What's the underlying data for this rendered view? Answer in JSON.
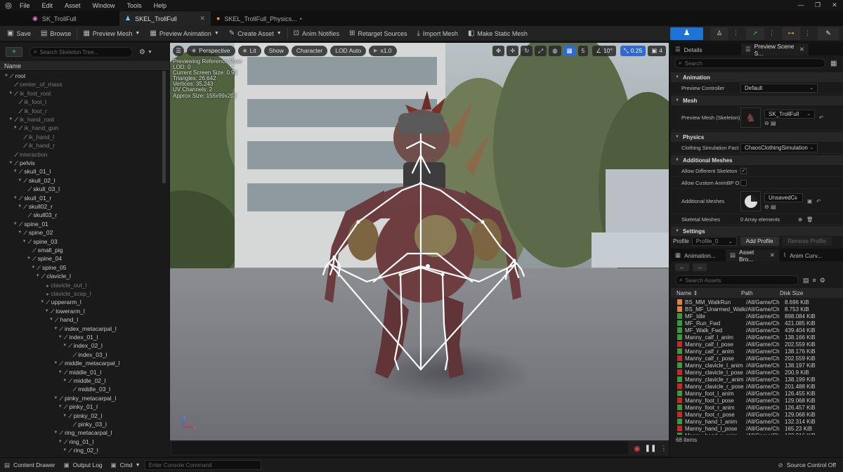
{
  "menu": {
    "items": [
      "File",
      "Edit",
      "Asset",
      "Window",
      "Tools",
      "Help"
    ]
  },
  "window_controls": {
    "min": "—",
    "max": "❐",
    "close": "✕"
  },
  "tabs": [
    {
      "label": "SK_TrollFull",
      "close": "✕"
    },
    {
      "label": "SKEL_TrollFull",
      "close": "✕"
    },
    {
      "label": "SKEL_TrollFull_Physics...",
      "close": "•"
    }
  ],
  "toolbar": {
    "save": "Save",
    "browse": "Browse",
    "preview_mesh": "Preview Mesh",
    "preview_animation": "Preview Animation",
    "create_asset": "Create Asset",
    "anim_notifies": "Anim Notifies",
    "retarget_sources": "Retarget Sources",
    "import_mesh": "Import Mesh",
    "make_static_mesh": "Make Static Mesh"
  },
  "skeleton_tree": {
    "search_placeholder": "Search Skeleton Tree...",
    "column_name": "Name",
    "rows": [
      {
        "label": "root",
        "depth": 0,
        "type": "bone",
        "toggle": true,
        "dim": false
      },
      {
        "label": "center_of_mass",
        "depth": 1,
        "type": "bone",
        "toggle": false,
        "dim": true
      },
      {
        "label": "ik_foot_root",
        "depth": 1,
        "type": "bone",
        "toggle": true,
        "dim": true
      },
      {
        "label": "ik_foot_l",
        "depth": 2,
        "type": "bone",
        "toggle": false,
        "dim": true
      },
      {
        "label": "ik_foot_r",
        "depth": 2,
        "type": "bone",
        "toggle": false,
        "dim": true
      },
      {
        "label": "ik_hand_root",
        "depth": 1,
        "type": "bone",
        "toggle": true,
        "dim": true
      },
      {
        "label": "ik_hand_gun",
        "depth": 2,
        "type": "bone",
        "toggle": true,
        "dim": true
      },
      {
        "label": "ik_hand_l",
        "depth": 3,
        "type": "bone",
        "toggle": false,
        "dim": true
      },
      {
        "label": "ik_hand_r",
        "depth": 3,
        "type": "bone",
        "toggle": false,
        "dim": true
      },
      {
        "label": "interaction",
        "depth": 1,
        "type": "bone",
        "toggle": false,
        "dim": true
      },
      {
        "label": "pelvis",
        "depth": 1,
        "type": "bone",
        "toggle": true,
        "dim": false
      },
      {
        "label": "skull_01_l",
        "depth": 2,
        "type": "bone",
        "toggle": true,
        "dim": false
      },
      {
        "label": "skull_02_l",
        "depth": 3,
        "type": "bone",
        "toggle": true,
        "dim": false
      },
      {
        "label": "skull_03_l",
        "depth": 4,
        "type": "bone",
        "toggle": false,
        "dim": false
      },
      {
        "label": "skull_01_r",
        "depth": 2,
        "type": "bone",
        "toggle": true,
        "dim": false
      },
      {
        "label": "skull02_r",
        "depth": 3,
        "type": "bone",
        "toggle": true,
        "dim": false
      },
      {
        "label": "skull03_r",
        "depth": 4,
        "type": "bone",
        "toggle": false,
        "dim": false
      },
      {
        "label": "spine_01",
        "depth": 2,
        "type": "bone",
        "toggle": true,
        "dim": false
      },
      {
        "label": "spine_02",
        "depth": 3,
        "type": "bone",
        "toggle": true,
        "dim": false
      },
      {
        "label": "spine_03",
        "depth": 4,
        "type": "bone",
        "toggle": true,
        "dim": false
      },
      {
        "label": "small_pig",
        "depth": 5,
        "type": "bone",
        "toggle": false,
        "dim": false
      },
      {
        "label": "spine_04",
        "depth": 5,
        "type": "bone",
        "toggle": true,
        "dim": false
      },
      {
        "label": "spine_05",
        "depth": 6,
        "type": "bone",
        "toggle": true,
        "dim": false
      },
      {
        "label": "clavicle_l",
        "depth": 7,
        "type": "bone",
        "toggle": true,
        "dim": false
      },
      {
        "label": "clavicle_out_l",
        "depth": 8,
        "type": "socket",
        "toggle": false,
        "dim": true
      },
      {
        "label": "clavicle_scap_l",
        "depth": 8,
        "type": "socket",
        "toggle": false,
        "dim": true
      },
      {
        "label": "upperarm_l",
        "depth": 8,
        "type": "bone",
        "toggle": true,
        "dim": false
      },
      {
        "label": "lowerarm_l",
        "depth": 9,
        "type": "bone",
        "toggle": true,
        "dim": false
      },
      {
        "label": "hand_l",
        "depth": 10,
        "type": "bone",
        "toggle": true,
        "dim": false
      },
      {
        "label": "index_metacarpal_l",
        "depth": 11,
        "type": "bone",
        "toggle": true,
        "dim": false
      },
      {
        "label": "index_01_l",
        "depth": 12,
        "type": "bone",
        "toggle": true,
        "dim": false
      },
      {
        "label": "index_02_l",
        "depth": 13,
        "type": "bone",
        "toggle": true,
        "dim": false
      },
      {
        "label": "index_03_l",
        "depth": 14,
        "type": "bone",
        "toggle": false,
        "dim": false
      },
      {
        "label": "middle_metacarpal_l",
        "depth": 11,
        "type": "bone",
        "toggle": true,
        "dim": false
      },
      {
        "label": "middle_01_l",
        "depth": 12,
        "type": "bone",
        "toggle": true,
        "dim": false
      },
      {
        "label": "middle_02_l",
        "depth": 13,
        "type": "bone",
        "toggle": true,
        "dim": false
      },
      {
        "label": "middle_03_l",
        "depth": 14,
        "type": "bone",
        "toggle": false,
        "dim": false
      },
      {
        "label": "pinky_metacarpal_l",
        "depth": 11,
        "type": "bone",
        "toggle": true,
        "dim": false
      },
      {
        "label": "pinky_01_l",
        "depth": 12,
        "type": "bone",
        "toggle": true,
        "dim": false
      },
      {
        "label": "pinky_02_l",
        "depth": 13,
        "type": "bone",
        "toggle": true,
        "dim": false
      },
      {
        "label": "pinky_03_l",
        "depth": 14,
        "type": "bone",
        "toggle": false,
        "dim": false
      },
      {
        "label": "ring_metacarpal_l",
        "depth": 11,
        "type": "bone",
        "toggle": true,
        "dim": false
      },
      {
        "label": "ring_01_l",
        "depth": 12,
        "type": "bone",
        "toggle": true,
        "dim": false
      },
      {
        "label": "ring_02_l",
        "depth": 13,
        "type": "bone",
        "toggle": true,
        "dim": false
      }
    ]
  },
  "viewport": {
    "perspective": "Perspective",
    "lit": "Lit",
    "show": "Show",
    "character": "Character",
    "lod": "LOD Auto",
    "play_rate": "x1.0",
    "grid_size": "5",
    "angle": "10°",
    "scale": "0.25",
    "camera_speed": "4",
    "info_lines": [
      "Previewing Reference Pose",
      "LOD: 0",
      "Current Screen Size: 0.92",
      "Triangles: 26,642",
      "Vertices: 35,243",
      "UV Channels: 2",
      "Approx Size: 156x99x202"
    ],
    "axis_z": "z",
    "axis_x": "x"
  },
  "details": {
    "tab_details": "Details",
    "tab_preview": "Preview Scene S...",
    "search_placeholder": "Search",
    "sec_animation": "Animation",
    "preview_controller_label": "Preview Controller",
    "preview_controller_value": "Default",
    "sec_mesh": "Mesh",
    "preview_mesh_label": "Preview Mesh (Skeleton)",
    "preview_mesh_value": "SK_TrollFull",
    "sec_physics": "Physics",
    "clothing_label": "Clothing Simulation Fact",
    "clothing_value": "ChaosClothingSimulation",
    "sec_additional": "Additional Meshes",
    "allow_diff_label": "Allow Different Skeleton",
    "allow_custom_label": "Allow Custom AnimBP O",
    "additional_meshes_label": "Additional Meshes",
    "additional_meshes_value": "UnsavedCo",
    "skeletal_meshes_label": "Skeletal Meshes",
    "skeletal_meshes_value": "0 Array elements",
    "sec_settings": "Settings",
    "profile_label": "Profile",
    "profile_value": "Profile_0",
    "add_profile": "Add Profile",
    "remove_profile": "Remove Profile"
  },
  "asset_browser": {
    "tab_animation": "Animation...",
    "tab_asset": "Asset Bro...",
    "tab_anim_curves": "Anim Curv...",
    "search_placeholder": "Search Assets",
    "col_name": "Name",
    "col_path": "Path",
    "col_size": "Disk Size",
    "rows": [
      {
        "name": "BS_MM_WalkRun",
        "path": "/All/Game/Ch",
        "size": "8.696 KiB",
        "color": "#d9824a"
      },
      {
        "name": "BS_MF_Unarmed_WalkF",
        "path": "/All/Game/Ch",
        "size": "8.753 KiB",
        "color": "#d9824a"
      },
      {
        "name": "MF_Idle",
        "path": "/All/Game/Ch",
        "size": "898.084 KiB",
        "color": "#3c9a3c"
      },
      {
        "name": "MF_Run_Fwd",
        "path": "/All/Game/Ch",
        "size": "421.085 KiB",
        "color": "#3c9a3c"
      },
      {
        "name": "MF_Walk_Fwd",
        "path": "/All/Game/Ch",
        "size": "439.404 KiB",
        "color": "#3c9a3c"
      },
      {
        "name": "Manny_calf_l_anim",
        "path": "/All/Game/Ch",
        "size": "138.166 KiB",
        "color": "#3c9a3c"
      },
      {
        "name": "Manny_calf_l_pose",
        "path": "/All/Game/Ch",
        "size": "202.559 KiB",
        "color": "#c8282a"
      },
      {
        "name": "Manny_calf_r_anim",
        "path": "/All/Game/Ch",
        "size": "138.176 KiB",
        "color": "#3c9a3c"
      },
      {
        "name": "Manny_calf_r_pose",
        "path": "/All/Game/Ch",
        "size": "202.559 KiB",
        "color": "#c8282a"
      },
      {
        "name": "Manny_clavicle_l_anim",
        "path": "/All/Game/Ch",
        "size": "138.197 KiB",
        "color": "#3c9a3c"
      },
      {
        "name": "Manny_clavicle_l_pose",
        "path": "/All/Game/Ch",
        "size": "200.9 KiB",
        "color": "#c8282a"
      },
      {
        "name": "Manny_clavicle_r_anim",
        "path": "/All/Game/Ch",
        "size": "138.199 KiB",
        "color": "#3c9a3c"
      },
      {
        "name": "Manny_clavicle_r_pose",
        "path": "/All/Game/Ch",
        "size": "201.488 KiB",
        "color": "#c8282a"
      },
      {
        "name": "Manny_foot_l_anim",
        "path": "/All/Game/Ch",
        "size": "126.455 KiB",
        "color": "#3c9a3c"
      },
      {
        "name": "Manny_foot_l_pose",
        "path": "/All/Game/Ch",
        "size": "129.068 KiB",
        "color": "#c8282a"
      },
      {
        "name": "Manny_foot_r_anim",
        "path": "/All/Game/Ch",
        "size": "126.457 KiB",
        "color": "#3c9a3c"
      },
      {
        "name": "Manny_foot_r_pose",
        "path": "/All/Game/Ch",
        "size": "129.068 KiB",
        "color": "#c8282a"
      },
      {
        "name": "Manny_hand_l_anim",
        "path": "/All/Game/Ch",
        "size": "132.314 KiB",
        "color": "#3c9a3c"
      },
      {
        "name": "Manny_hand_l_pose",
        "path": "/All/Game/Ch",
        "size": "165.23 KiB",
        "color": "#c8282a"
      },
      {
        "name": "Manny_hand_r_anim",
        "path": "/All/Game/Ch",
        "size": "132.316 KiB",
        "color": "#3c9a3c"
      }
    ],
    "item_count": "68 items"
  },
  "statusbar": {
    "content_drawer": "Content Drawer",
    "output_log": "Output Log",
    "cmd": "Cmd",
    "console_placeholder": "Enter Console Command",
    "source_control": "Source Control Off"
  },
  "colors": {
    "accent_blue": "#2f6ad0",
    "bone_white": "#ffffff",
    "green_add": "#3cb442"
  }
}
